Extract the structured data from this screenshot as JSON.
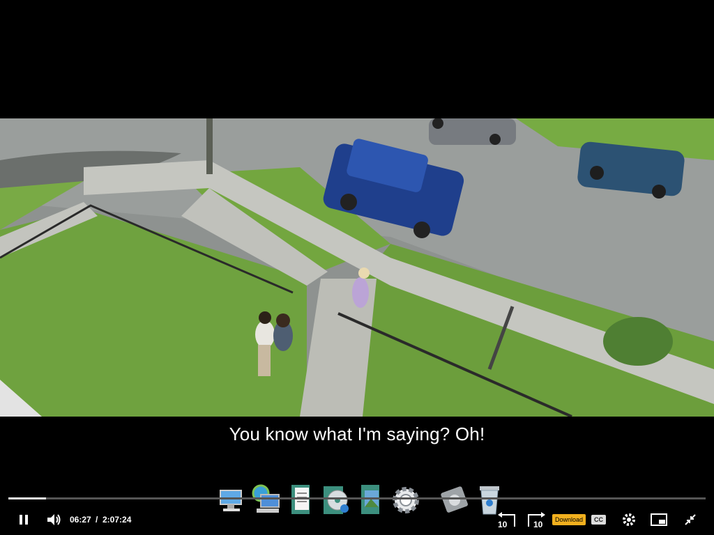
{
  "player": {
    "subtitle": "You know what I'm saying? Oh!",
    "current_time": "06:27",
    "separator": "/",
    "duration": "2:07:24",
    "progress_fraction": 0.054,
    "download_label": "Download",
    "cc_label": "CC",
    "skip_back_label": "10",
    "skip_forward_label": "10"
  },
  "taskbar_icons": [
    "computer-icon",
    "network-icon",
    "document-icon",
    "music-cd-icon",
    "pictures-icon",
    "settings-gear-icon",
    "hard-drive-icon",
    "recycle-bin-icon"
  ],
  "colors": {
    "download_bg": "#f2b01e",
    "background": "#000000"
  }
}
